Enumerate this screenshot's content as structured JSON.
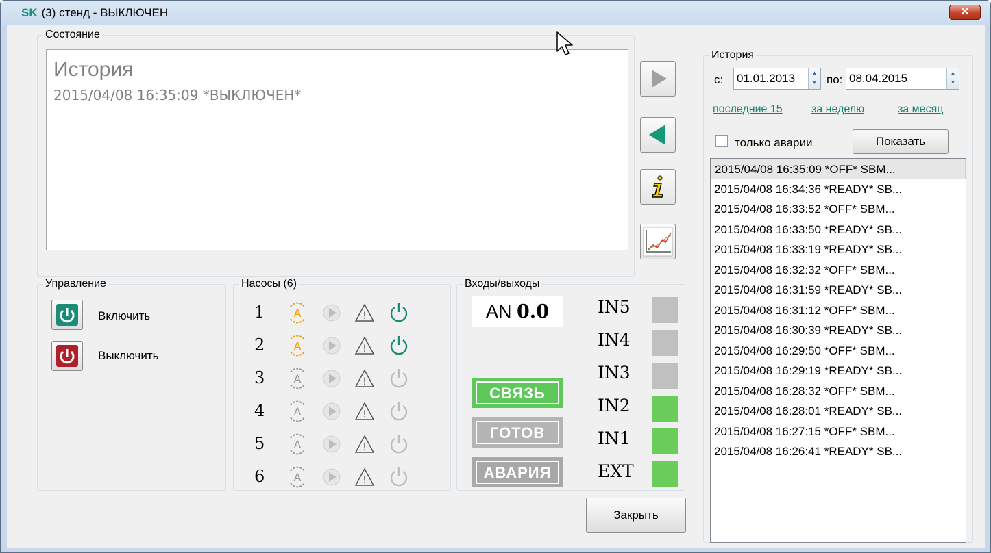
{
  "window": {
    "title_prefix": "SK",
    "title": "(3) стенд - ВЫКЛЮЧЕН",
    "close_glyph": "✕"
  },
  "state": {
    "group_label": "Состояние",
    "heading": "История",
    "line": "2015/04/08 16:35:09 *ВЫКЛЮЧЕН*"
  },
  "side_buttons": [
    {
      "name": "forward-button",
      "icon": "play-right-icon"
    },
    {
      "name": "back-button",
      "icon": "play-left-icon"
    },
    {
      "name": "info-button",
      "icon": "info-icon"
    },
    {
      "name": "chart-button",
      "icon": "chart-icon"
    }
  ],
  "control": {
    "group_label": "Управление",
    "on_label": "Включить",
    "off_label": "Выключить"
  },
  "pumps": {
    "group_label": "Насосы (6)",
    "rows": [
      {
        "num": "1",
        "auto_active": true,
        "power_on": true
      },
      {
        "num": "2",
        "auto_active": true,
        "power_on": true
      },
      {
        "num": "3",
        "auto_active": false,
        "power_on": false
      },
      {
        "num": "4",
        "auto_active": false,
        "power_on": false
      },
      {
        "num": "5",
        "auto_active": false,
        "power_on": false
      },
      {
        "num": "6",
        "auto_active": false,
        "power_on": false
      }
    ]
  },
  "io": {
    "group_label": "Входы/выходы",
    "an_label": "AN",
    "an_value": "0.0",
    "badges": [
      {
        "label": "СВЯЗЬ",
        "color": "#5fc85a"
      },
      {
        "label": "ГОТОВ",
        "color": "#b4b4b4"
      },
      {
        "label": "АВАРИЯ",
        "color": "#a8a8a8"
      }
    ],
    "inputs": [
      {
        "label": "IN5",
        "on": false
      },
      {
        "label": "IN4",
        "on": false
      },
      {
        "label": "IN3",
        "on": false
      },
      {
        "label": "IN2",
        "on": true
      },
      {
        "label": "IN1",
        "on": true
      },
      {
        "label": "EXT",
        "on": true
      }
    ]
  },
  "history": {
    "group_label": "История",
    "from_label": "с:",
    "from_value": "01.01.2013",
    "to_label": "по:",
    "to_value": "08.04.2015",
    "link_last15": "последние 15",
    "link_week": "за неделю",
    "link_month": "за месяц",
    "alarms_only_label": "только аварии",
    "show_label": "Показать",
    "items": [
      "2015/04/08 16:35:09 *OFF* SBM...",
      "2015/04/08 16:34:36 *READY* SB...",
      "2015/04/08 16:33:52 *OFF* SBM...",
      "2015/04/08 16:33:50 *READY* SB...",
      "2015/04/08 16:33:19 *READY* SB...",
      "2015/04/08 16:32:32 *OFF* SBM...",
      "2015/04/08 16:31:59 *READY* SB...",
      "2015/04/08 16:31:12 *OFF* SBM...",
      "2015/04/08 16:30:39 *READY* SB...",
      "2015/04/08 16:29:50 *OFF* SBM...",
      "2015/04/08 16:29:19 *READY* SB...",
      "2015/04/08 16:28:32 *OFF* SBM...",
      "2015/04/08 16:28:01 *READY* SB...",
      "2015/04/08 16:27:15 *OFF* SBM...",
      "2015/04/08 16:26:41 *READY* SB..."
    ]
  },
  "close_button_label": "Закрыть",
  "colors": {
    "accent_teal": "#1a8c78",
    "lamp_on": "#6cce5a",
    "lamp_off": "#c0c0c0",
    "auto_active": "#f0a000"
  }
}
